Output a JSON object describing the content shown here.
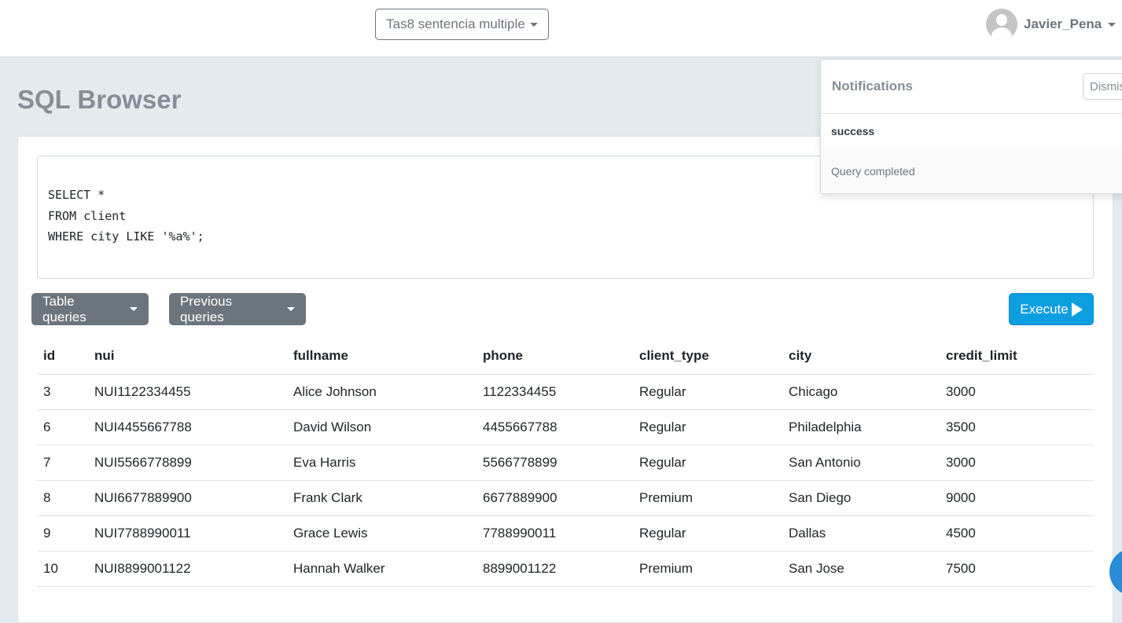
{
  "navbar": {
    "project": "Tas8 sentencia multiple",
    "user": "Javier_Pena"
  },
  "page": {
    "title": "SQL Browser"
  },
  "editor": {
    "query": "SELECT *\nFROM client\nWHERE city LIKE '%a%';"
  },
  "toolbar": {
    "table_queries": "Table queries",
    "previous_queries": "Previous queries",
    "execute": "Execute"
  },
  "table": {
    "columns": [
      "id",
      "nui",
      "fullname",
      "phone",
      "client_type",
      "city",
      "credit_limit"
    ],
    "rows": [
      [
        "3",
        "NUI1122334455",
        "Alice Johnson",
        "1122334455",
        "Regular",
        "Chicago",
        "3000"
      ],
      [
        "6",
        "NUI4455667788",
        "David Wilson",
        "4455667788",
        "Regular",
        "Philadelphia",
        "3500"
      ],
      [
        "7",
        "NUI5566778899",
        "Eva Harris",
        "5566778899",
        "Regular",
        "San Antonio",
        "3000"
      ],
      [
        "8",
        "NUI6677889900",
        "Frank Clark",
        "6677889900",
        "Premium",
        "San Diego",
        "9000"
      ],
      [
        "9",
        "NUI7788990011",
        "Grace Lewis",
        "7788990011",
        "Regular",
        "Dallas",
        "4500"
      ],
      [
        "10",
        "NUI8899001122",
        "Hannah Walker",
        "8899001122",
        "Premium",
        "San Jose",
        "7500"
      ]
    ]
  },
  "notifications": {
    "title": "Notifications",
    "dismiss": "Dismiss",
    "items": [
      {
        "type": "success",
        "message": "Query completed"
      }
    ]
  }
}
